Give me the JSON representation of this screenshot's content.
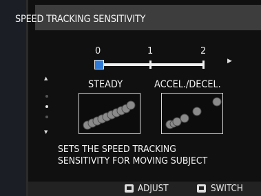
{
  "menu": {
    "title": "SPEED TRACKING SENSITIVITY",
    "scale": {
      "labels": [
        "0",
        "1",
        "2"
      ],
      "selected_index": 0
    },
    "options": [
      {
        "label": "STEADY"
      },
      {
        "label": "ACCEL./DECEL."
      }
    ],
    "description": [
      "SETS THE SPEED TRACKING",
      "SENSITIVITY FOR MOVING SUBJECT"
    ],
    "page_indicator": {
      "pages": 3,
      "current": 1
    },
    "icons": {
      "up": "up-arrow-icon",
      "down": "down-arrow-icon",
      "right": "right-arrow-icon",
      "adjust": "dial-icon",
      "switch": "button-icon"
    },
    "colors": {
      "accent": "#2f7ad6",
      "title_bar": "#3d3d3d",
      "background": "#101010"
    }
  },
  "footer": {
    "adjust_label": "ADJUST",
    "switch_label": "SWITCH"
  }
}
